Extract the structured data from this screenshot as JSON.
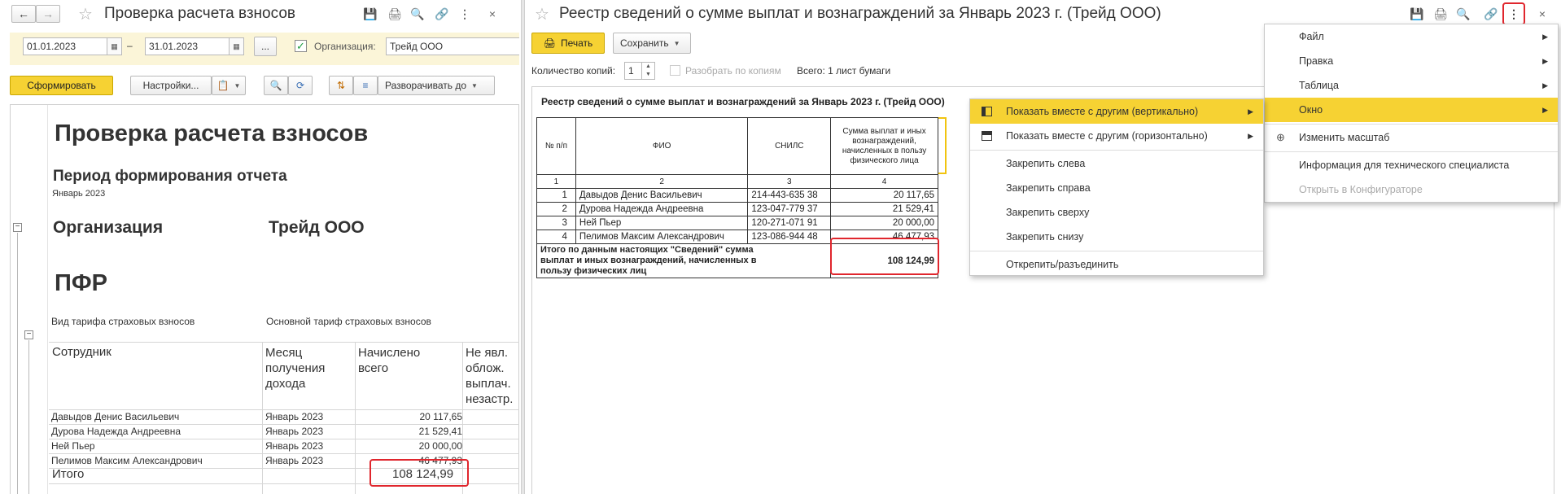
{
  "left": {
    "title": "Проверка расчета взносов",
    "date_from": "01.01.2023",
    "date_sep": "–",
    "date_to": "31.01.2023",
    "ellipsis": "...",
    "org_label": "Организация:",
    "org_value": "Трейд ООО",
    "generate_label": "Сформировать",
    "settings_label": "Настройки...",
    "expand_label": "Разворачивать до",
    "report": {
      "heading": "Проверка расчета взносов",
      "period_label": "Период формирования отчета",
      "period_value": "Январь 2023",
      "org_label": "Организация",
      "org_value": "Трейд ООО",
      "section": "ПФР",
      "tariff_label": "Вид тарифа страховых взносов",
      "tariff_value": "Основной тариф страховых взносов",
      "columns": [
        "Сотрудник",
        "Месяц получения дохода",
        "Начислено всего",
        "Не явл. облож. выплач. незастр."
      ],
      "rows": [
        {
          "name": "Давыдов Денис Васильевич",
          "month": "Январь 2023",
          "amount": "20 117,65"
        },
        {
          "name": "Дурова Надежда Андреевна",
          "month": "Январь 2023",
          "amount": "21 529,41"
        },
        {
          "name": "Ней Пьер",
          "month": "Январь 2023",
          "amount": "20 000,00"
        },
        {
          "name": "Пелимов Максим Александрович",
          "month": "Январь 2023",
          "amount": "46 477,93"
        }
      ],
      "total_label": "Итого",
      "total_value": "108 124,99"
    }
  },
  "right": {
    "title": "Реестр сведений о сумме выплат и вознаграждений за Январь 2023 г. (Трейд ООО)",
    "print_label": "Печать",
    "save_label": "Сохранить",
    "copies_label": "Количество копий:",
    "copies_value": "1",
    "split_label": "Разобрать по копиям",
    "total_sheets": "Всего: 1 лист бумаги",
    "doc_title": "Реестр сведений о сумме выплат и вознаграждений за Январь 2023 г. (Трейд ООО)",
    "table": {
      "h_num": "№ п/п",
      "h_fio": "ФИО",
      "h_snils": "СНИЛС",
      "h_sum": "Сумма выплат и иных вознаграждений, начисленных в пользу физического лица",
      "idx": [
        "1",
        "2",
        "3",
        "4"
      ],
      "rows": [
        {
          "n": "1",
          "fio": "Давыдов Денис Васильевич",
          "snils": "214-443-635 38",
          "sum": "20 117,65"
        },
        {
          "n": "2",
          "fio": "Дурова Надежда Андреевна",
          "snils": "123-047-779 37",
          "sum": "21 529,41"
        },
        {
          "n": "3",
          "fio": "Ней Пьер",
          "snils": "120-271-071 91",
          "sum": "20 000,00"
        },
        {
          "n": "4",
          "fio": "Пелимов Максим Александрович",
          "snils": "123-086-944 48",
          "sum": "46 477,93"
        }
      ],
      "total_label": "Итого по данным настоящих \"Сведений\" сумма выплат и иных вознаграждений, начисленных в пользу физических лиц",
      "total_value": "108 124,99"
    }
  },
  "main_menu": {
    "items": [
      {
        "label": "Файл"
      },
      {
        "label": "Правка"
      },
      {
        "label": "Таблица"
      },
      {
        "label": "Окно"
      },
      {
        "label": "Изменить масштаб"
      },
      {
        "label": "Информация для технического специалиста"
      },
      {
        "label": "Открыть в Конфигураторе"
      }
    ]
  },
  "window_submenu": {
    "items": [
      {
        "label": "Показать вместе с другим (вертикально)"
      },
      {
        "label": "Показать вместе с другим (горизонтально)"
      },
      {
        "label": "Закрепить слева"
      },
      {
        "label": "Закрепить справа"
      },
      {
        "label": "Закрепить сверху"
      },
      {
        "label": "Закрепить снизу"
      },
      {
        "label": "Открепить/разъединить"
      }
    ]
  },
  "colors": {
    "accent": "#f6d233",
    "highlight_red": "#e0262d",
    "green": "#1c9e3f"
  }
}
